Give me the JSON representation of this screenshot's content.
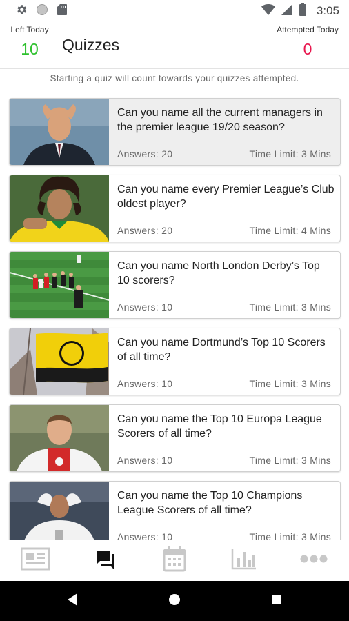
{
  "status_bar": {
    "time": "3:05",
    "icons": [
      "gear-icon",
      "circle-icon",
      "sd-card-icon",
      "wifi-icon",
      "signal-icon",
      "battery-icon"
    ]
  },
  "header": {
    "left_stat": {
      "label": "Left Today",
      "value": "10"
    },
    "title": "Quizzes",
    "right_stat": {
      "label": "Attempted Today",
      "value": "0"
    }
  },
  "notice": "Starting a quiz will count towards your quizzes attempted.",
  "colors": {
    "left_value": "#2ec12e",
    "attempted_value": "#e8184f",
    "nav_active": "#111111",
    "nav_inactive": "#c8c8c8"
  },
  "quizzes": [
    {
      "question": "Can you name all the current managers in the premier league 19/20 season?",
      "answers": "Answers: 20",
      "time_limit": "Time Limit: 3 Mins"
    },
    {
      "question": "Can you name every Premier League’s Club oldest player?",
      "answers": "Answers: 20",
      "time_limit": "Time Limit: 4 Mins"
    },
    {
      "question": "Can you name North London Derby’s Top 10 scorers?",
      "answers": "Answers: 10",
      "time_limit": "Time Limit: 3 Mins"
    },
    {
      "question": "Can you name Dortmund’s Top 10 Scorers of all time?",
      "answers": "Answers: 10",
      "time_limit": "Time Limit: 3 Mins"
    },
    {
      "question": "Can you name the Top 10 Europa League Scorers of all time?",
      "answers": "Answers: 10",
      "time_limit": "Time Limit: 3 Mins"
    },
    {
      "question": "Can you name the Top 10 Champions League Scorers of all time?",
      "answers": "Answers: 10",
      "time_limit": "Time Limit: 3 Mins"
    }
  ],
  "bottom_nav": [
    "news-icon",
    "quiz-chat-icon",
    "calendar-icon",
    "stats-chart-icon",
    "more-icon"
  ],
  "system_nav": [
    "back-icon",
    "home-icon",
    "recents-icon"
  ]
}
